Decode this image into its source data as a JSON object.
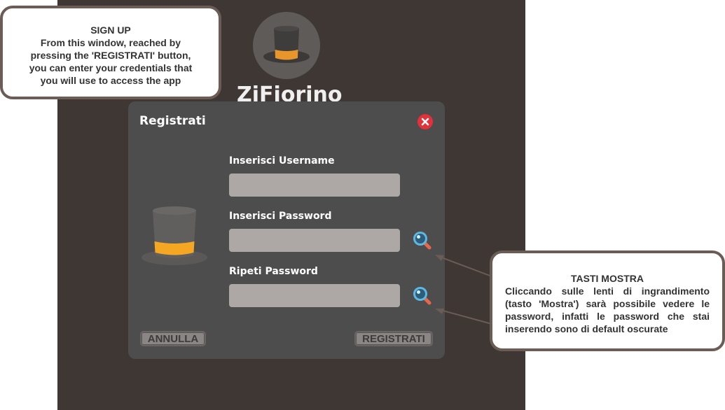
{
  "app": {
    "name": "ZiFiorino"
  },
  "dialog": {
    "title": "Registrati",
    "username": {
      "label": "Inserisci Username",
      "value": "",
      "placeholder": ""
    },
    "password": {
      "label": "Inserisci Password",
      "value": "",
      "placeholder": ""
    },
    "repeat_password": {
      "label": "Ripeti Password",
      "value": "",
      "placeholder": ""
    },
    "cancel_label": "ANNULLA",
    "register_label": "REGISTRATI"
  },
  "annotations": {
    "signup": {
      "title": "SIGN UP",
      "lines": [
        "From this window, reached by",
        "pressing the 'REGISTRATI' button,",
        "you can enter your credentials that",
        "you will use to access the app"
      ]
    },
    "show_buttons": {
      "title": "TASTI MOSTRA",
      "body": "Cliccando sulle lenti di ingrandimento (tasto 'Mostra') sarà possibile vedere le password, infatti le password che stai inserendo sono di default oscurate"
    }
  },
  "colors": {
    "app_background": "#3f3733",
    "dialog_background": "#4d4d4d",
    "field_background": "#ada7a6",
    "close_red": "#e3313b",
    "hat_band": "#f5a623",
    "callout_border": "#6b5c56"
  },
  "icons": [
    "top-hat-icon",
    "close-icon",
    "magnifier-icon"
  ]
}
